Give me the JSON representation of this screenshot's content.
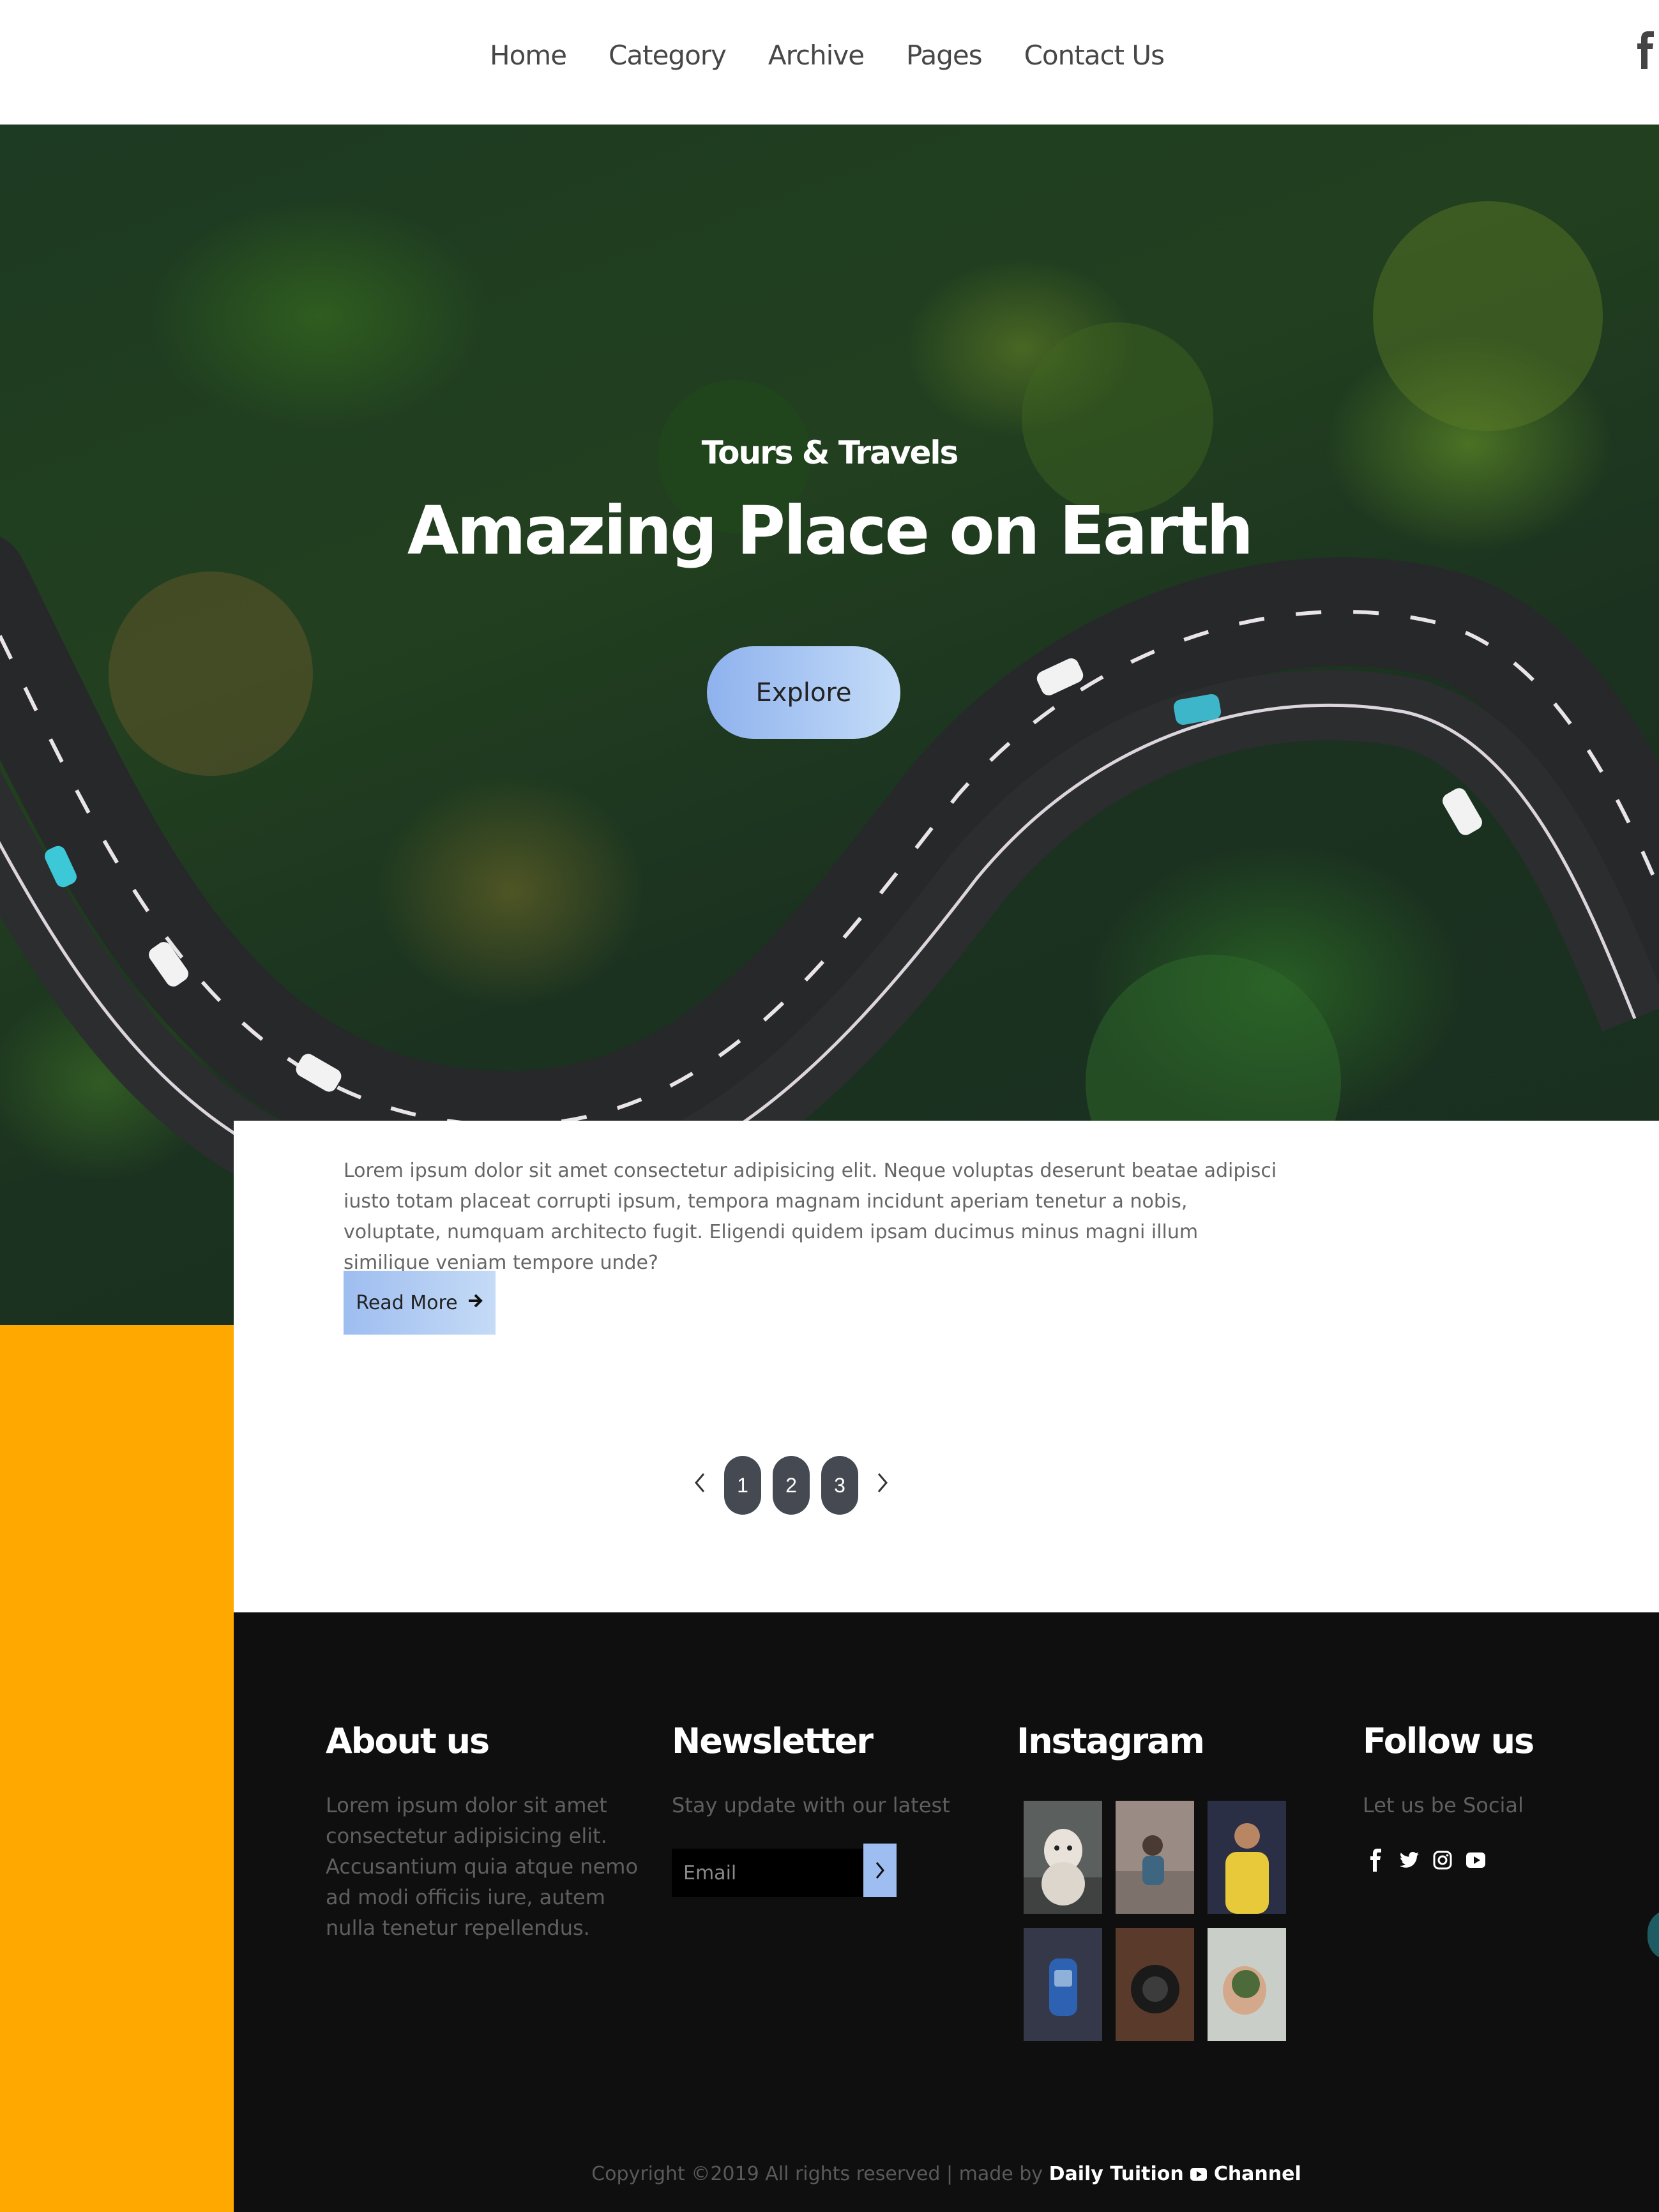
{
  "nav": {
    "items": [
      "Home",
      "Category",
      "Archive",
      "Pages",
      "Contact Us"
    ],
    "social_icon": "facebook-icon"
  },
  "hero": {
    "subtitle": "Tours & Travels",
    "title": "Amazing Place on Earth",
    "button_label": "Explore"
  },
  "article": {
    "excerpt": "Lorem ipsum dolor sit amet consectetur adipisicing elit. Neque voluptas deserunt beatae adipisci iusto totam placeat corrupti ipsum, tempora magnam incidunt aperiam tenetur a nobis, voluptate, numquam architecto fugit. Eligendi quidem ipsam ducimus minus magni illum similique veniam tempore unde?",
    "read_more_label": "Read More"
  },
  "pagination": {
    "prev_icon": "chevron-left-icon",
    "next_icon": "chevron-right-icon",
    "pages": [
      "1",
      "2",
      "3"
    ]
  },
  "footer": {
    "about": {
      "title": "About us",
      "text": "Lorem ipsum dolor sit amet consectetur adipisicing elit. Accusantium quia atque nemo ad modi officiis iure, autem nulla tenetur repellendus."
    },
    "newsletter": {
      "title": "Newsletter",
      "text": "Stay update with our latest",
      "email_placeholder": "Email"
    },
    "instagram": {
      "title": "Instagram",
      "photos": [
        "dog-photo",
        "woman-sitting-photo",
        "man-yellow-shirt-photo",
        "blue-car-photo",
        "camera-photo",
        "hand-holding-lens-photo"
      ]
    },
    "follow": {
      "title": "Follow us",
      "text": "Let us be Social",
      "icons": [
        "facebook-icon",
        "twitter-icon",
        "instagram-icon",
        "youtube-icon"
      ]
    },
    "copyright": {
      "prefix": "Copyright ©2019 All rights reserved | made by",
      "brand_a": "Daily Tuition",
      "brand_b": "Channel"
    }
  },
  "colors": {
    "accent_orange": "#ffa800",
    "button_blue": "#9ebdf0",
    "footer_bg": "#0f0f0f",
    "pager_dark": "#454a52"
  }
}
